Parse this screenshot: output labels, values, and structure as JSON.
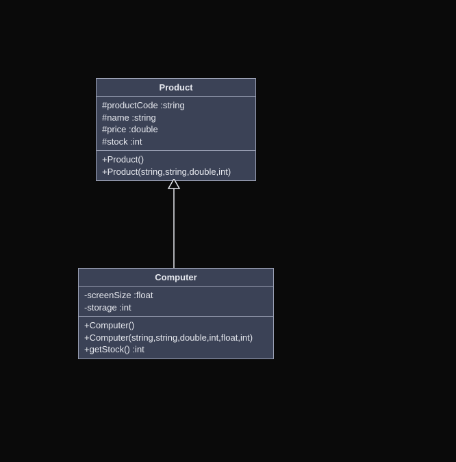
{
  "colors": {
    "bg": "#0a0a0a",
    "box_fill": "#3b4256",
    "box_border": "#9aa0b4",
    "text": "#e6e8ee"
  },
  "classes": {
    "product": {
      "title": "Product",
      "attrs": [
        "#productCode :string",
        "#name :string",
        "#price :double",
        "#stock :int"
      ],
      "ops": [
        "+Product()",
        "+Product(string,string,double,int)"
      ]
    },
    "computer": {
      "title": "Computer",
      "attrs": [
        "-screenSize :float",
        "-storage :int"
      ],
      "ops": [
        "+Computer()",
        "+Computer(string,string,double,int,float,int)",
        "+getStock() :int"
      ]
    }
  },
  "relation": {
    "type": "generalization",
    "child": "computer",
    "parent": "product"
  }
}
